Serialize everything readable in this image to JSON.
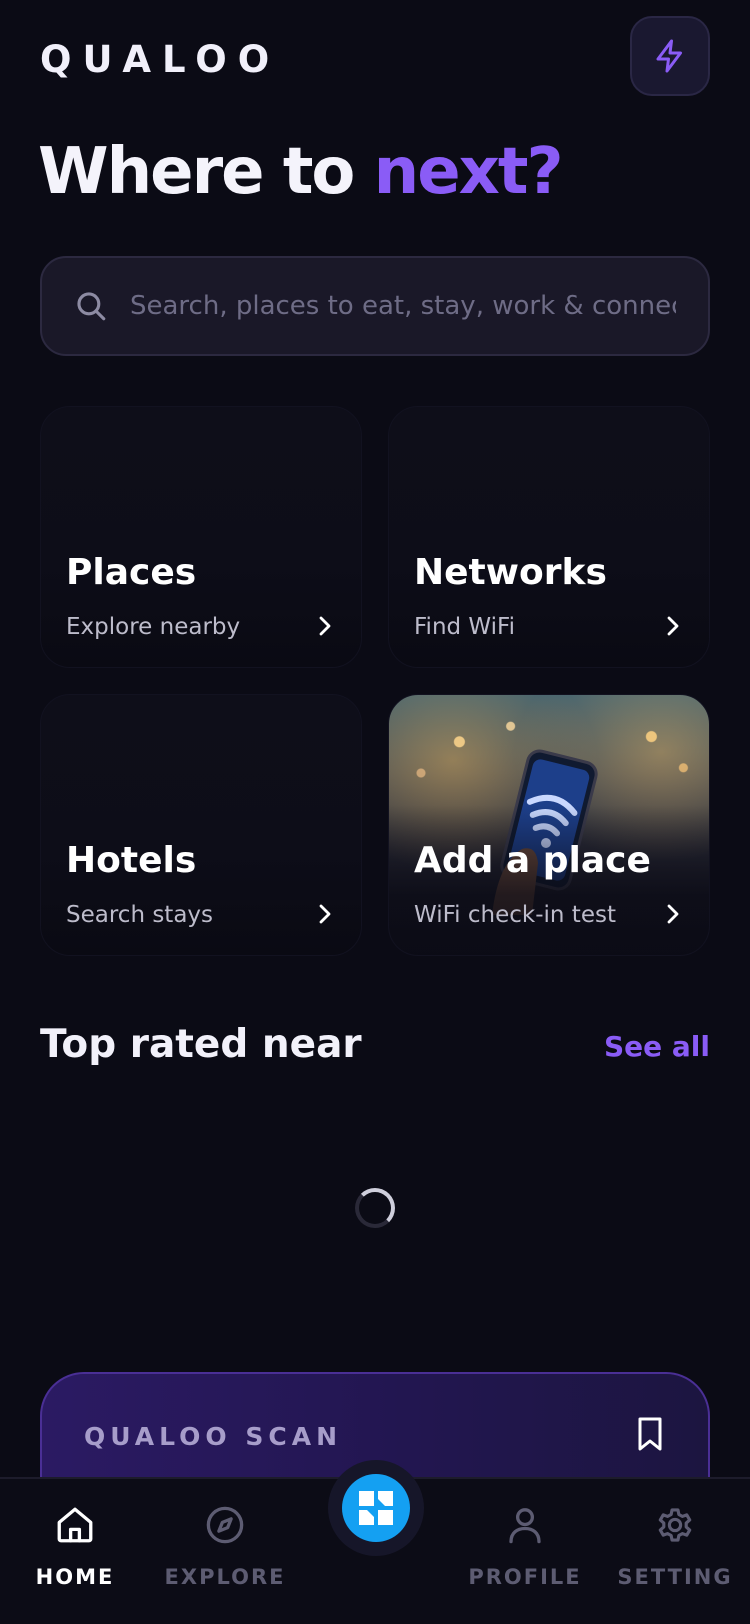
{
  "header": {
    "brand": "QUALOO",
    "headline_main": "Where to ",
    "headline_accent": "next?"
  },
  "search": {
    "placeholder": "Search, places to eat, stay, work & connect",
    "value": ""
  },
  "tiles": [
    {
      "title": "Places",
      "subtitle": "Explore nearby"
    },
    {
      "title": "Networks",
      "subtitle": "Find WiFi"
    },
    {
      "title": "Hotels",
      "subtitle": "Search stays"
    },
    {
      "title": "Add a place",
      "subtitle": "WiFi check-in test"
    }
  ],
  "top_rated": {
    "title": "Top rated near",
    "see_all": "See all"
  },
  "scan_card": {
    "label": "QUALOO SCAN"
  },
  "nav": {
    "items": [
      {
        "label": "HOME",
        "icon": "home-icon"
      },
      {
        "label": "EXPLORE",
        "icon": "compass-icon"
      },
      {
        "label": "PROFILE",
        "icon": "user-icon"
      },
      {
        "label": "SETTING",
        "icon": "gear-icon"
      }
    ],
    "center_icon": "scan-icon"
  },
  "colors": {
    "background": "#0b0b15",
    "accent": "#8a5cf6",
    "fab": "#14a0f2",
    "scan_card": "#2b1a63"
  }
}
